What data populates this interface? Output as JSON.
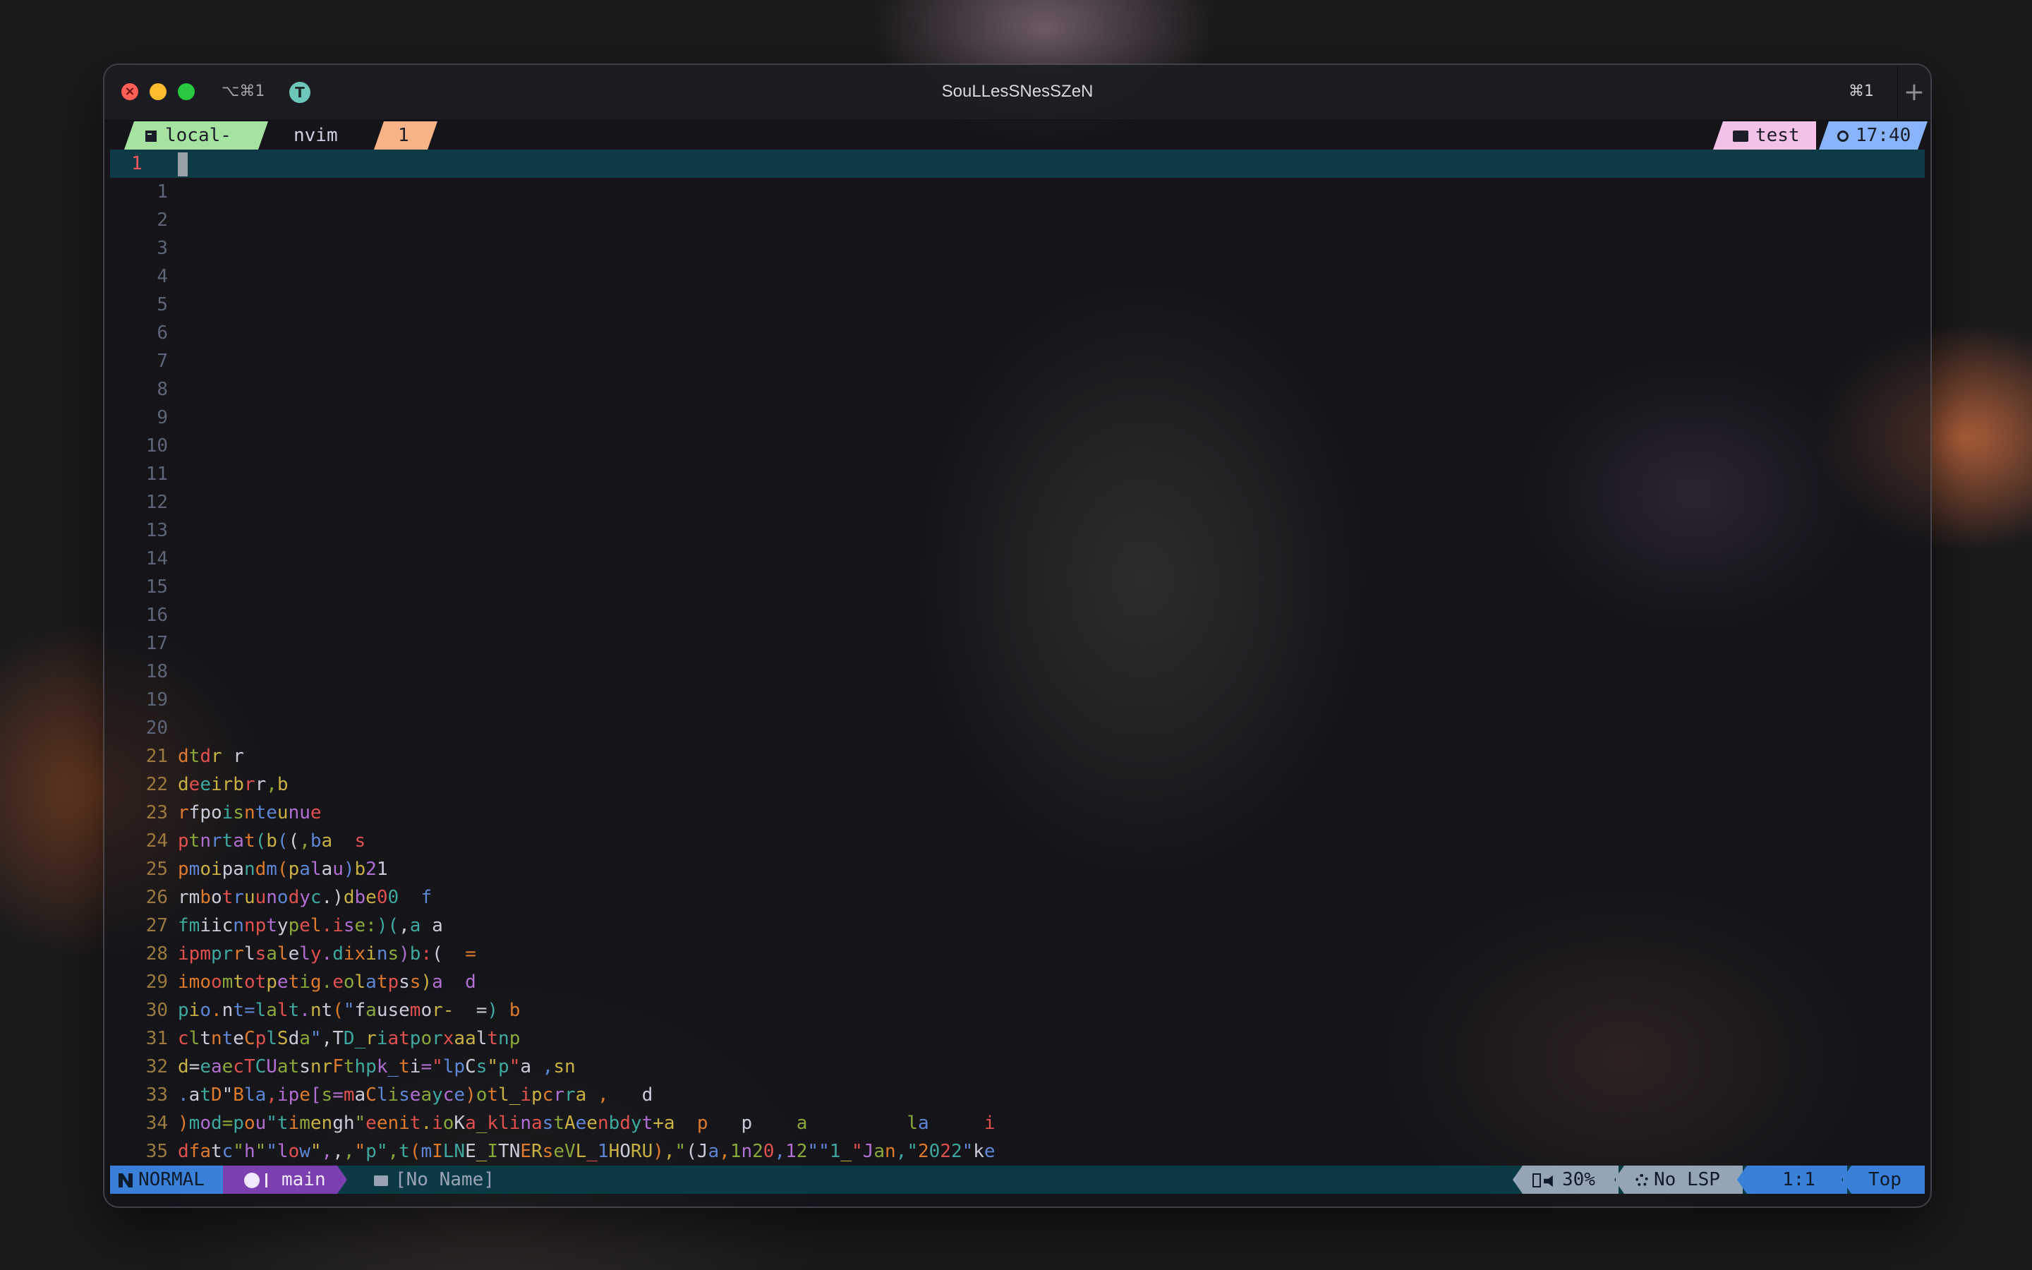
{
  "titlebar": {
    "shortcut": "⌥⌘1",
    "avatar_letter": "T",
    "title": "SouLLesSNesSZeN",
    "right_shortcut": "⌘1",
    "new_tab_label": "+"
  },
  "tmux": {
    "session": "local-main",
    "window_name": "nvim",
    "window_index": "1",
    "directory": "test",
    "time": "17:40"
  },
  "editor": {
    "cursor_line_number": "1",
    "line_numbers": [
      "1",
      "2",
      "3",
      "4",
      "5",
      "6",
      "7",
      "8",
      "9",
      "10",
      "11",
      "12",
      "13",
      "14",
      "15",
      "16",
      "17",
      "18",
      "19",
      "20",
      "21",
      "22",
      "23",
      "24",
      "25",
      "26",
      "27",
      "28",
      "29",
      "30",
      "31",
      "32",
      "33",
      "34",
      "35"
    ],
    "code_lines": [
      "",
      "",
      "",
      "",
      "",
      "",
      "",
      "",
      "",
      "",
      "",
      "",
      "",
      "",
      "",
      "",
      "",
      "",
      "",
      "",
      "dtdr r",
      "deeirbrr,b",
      "rfpoisnteunue",
      "ptnrtat(b((,ba  s",
      "pmoipandm(palau)b21",
      "rmbotruunodyc.)dbe00  f",
      "fmiicnnptypel.ise:)(,a a",
      "ipmprrlsalely.dixins)b:(  =",
      "imoomtotpetig.eolatpss)a  d",
      "pio.nt=lalt.nt(\"fausemor-  =) b",
      "cltnteCplSda\",TD_riatporxaaltnp",
      "d=eaecTCUatsnrFthpk_ti=\"lpCs\"p\"a ,sn",
      ".atD\"Bla,ipe[s=maCliseayce)otl_ipcrra ,   d",
      ")mod=pou\"timengh\"eenit.ioKa_klinastAeenbdyt+a  p   p    a         la     i",
      "dfatc\"h\"\"low\",,,\"p\",t(mILNE_ITNERseVL_1HORU),\"(Ja,1n20,12\"\"1_\"Jan,\"2022\"ke"
    ]
  },
  "statusline": {
    "mode": "NORMAL",
    "branch": "main",
    "file": "[No Name]",
    "battery": "30%",
    "lsp": "No LSP",
    "position": "1:1",
    "scroll": "Top"
  },
  "colors": {
    "session_bg": "#a6e3a1",
    "index_bg": "#fab387",
    "dir_bg": "#f5c2e7",
    "time_bg": "#89b4fa",
    "mode_bg": "#3a7fd8",
    "branch_bg": "#7c3fb0",
    "cursorline_bg": "#0e3a45"
  }
}
